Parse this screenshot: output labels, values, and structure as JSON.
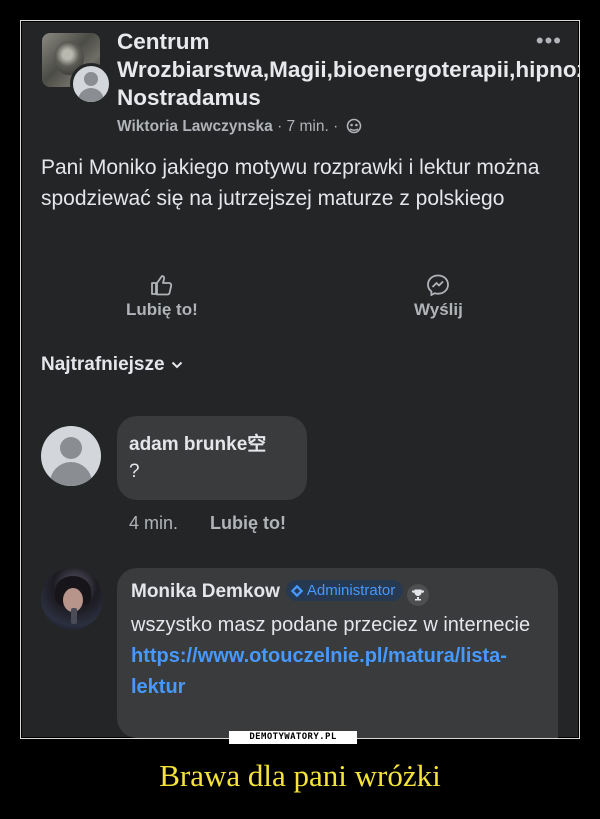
{
  "post": {
    "group_name": "Centrum Wrozbiarstwa,Magii,bioenergoterapii,hipnozy Nostradamus",
    "author": "Wiktoria Lawczynska",
    "time": " · 7 min. · ",
    "more": "•••",
    "text": "Pani Moniko jakiego motywu rozprawki i lektur można spodziewać się na jutrzejszej maturze z polskiego",
    "like_label": "Lubię to!",
    "send_label": "Wyślij"
  },
  "sort": {
    "label": "Najtrafniejsze"
  },
  "comments": [
    {
      "author": "adam brunke空",
      "text": "?",
      "time": "4 min.",
      "like_label": "Lubię to!"
    },
    {
      "author": "Monika Demkow",
      "badge": "Administrator",
      "text": "wszystko masz podane przeciez w internecie",
      "link": "https://www.otouczelnie.pl/matura/lista-lektur"
    }
  ],
  "watermark": "DEMOTYWATORY.PL",
  "caption": "Brawa dla pani wróżki",
  "colors": {
    "background": "#242526",
    "bubble": "#3a3b3c",
    "link": "#4599ff",
    "caption": "#f5e23a"
  }
}
